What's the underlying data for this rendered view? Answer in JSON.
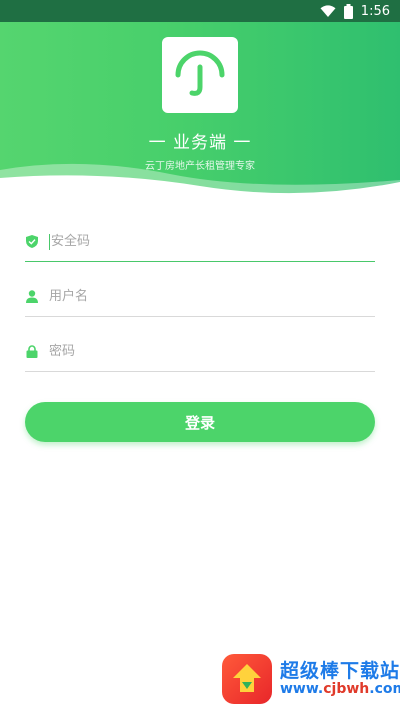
{
  "status_bar": {
    "time": "1:56",
    "wifi_icon": "wifi-icon",
    "battery_icon": "battery-icon"
  },
  "header": {
    "title": "一 业务端 一",
    "subtitle": "云丁房地产长租管理专家",
    "logo_icon": "umbrella-j-logo-icon",
    "accent": "#4cd46a"
  },
  "form": {
    "security_code": {
      "placeholder": "安全码",
      "value": "",
      "icon": "shield-check-icon"
    },
    "username": {
      "placeholder": "用户名",
      "value": "",
      "icon": "user-icon"
    },
    "password": {
      "placeholder": "密码",
      "value": "",
      "icon": "lock-icon"
    },
    "login_label": "登录"
  },
  "watermark": {
    "name": "超级棒下载站",
    "url_prefix": "www.",
    "url_host": "cjbwh",
    "url_suffix": ".com"
  }
}
